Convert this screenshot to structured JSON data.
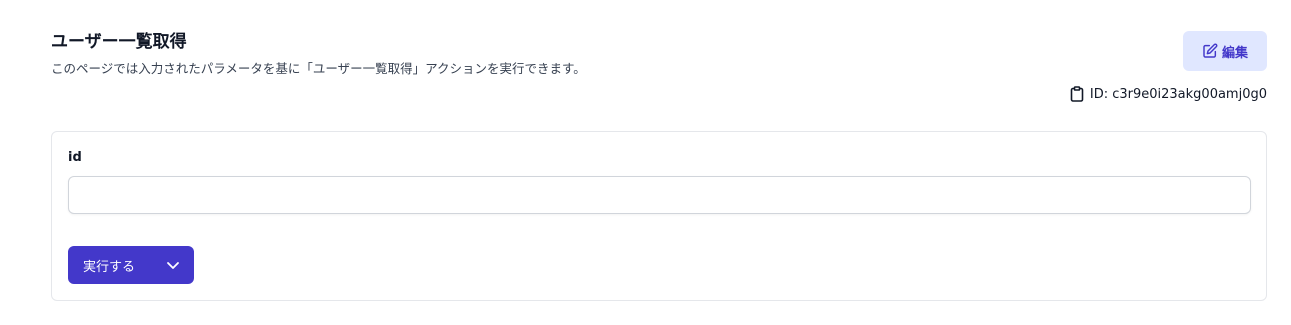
{
  "header": {
    "title": "ユーザー一覧取得",
    "description": "このページでは入力されたパラメータを基に「ユーザー一覧取得」アクションを実行できます。"
  },
  "edit_button": {
    "label": "編集",
    "icon": "pencil-square-icon"
  },
  "id_info": {
    "text": "ID: c3r9e0i23akg00amj0g0",
    "icon": "clipboard-icon"
  },
  "form": {
    "fields": [
      {
        "label": "id",
        "value": "",
        "placeholder": ""
      }
    ],
    "run_button": {
      "label": "実行する",
      "dropdown_icon": "chevron-down-icon"
    }
  },
  "colors": {
    "accent": "#4338ca",
    "accent_light": "#e0e7ff",
    "border": "#e5e7eb"
  }
}
